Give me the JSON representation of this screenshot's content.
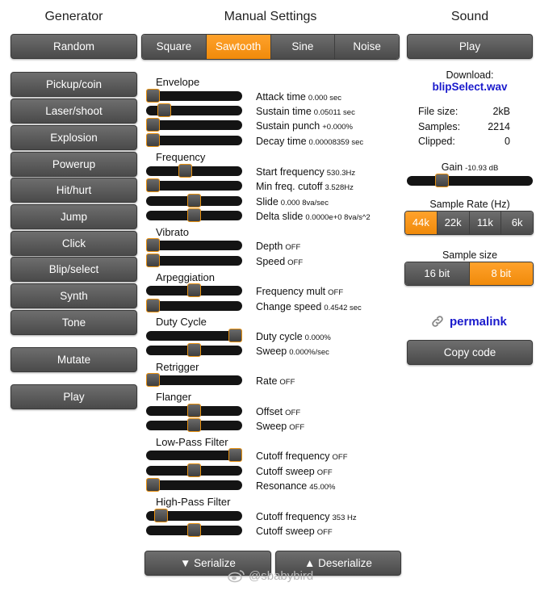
{
  "headers": {
    "generator": "Generator",
    "manual": "Manual Settings",
    "sound": "Sound"
  },
  "generator": {
    "random": "Random",
    "presets": [
      "Pickup/coin",
      "Laser/shoot",
      "Explosion",
      "Powerup",
      "Hit/hurt",
      "Jump",
      "Click",
      "Blip/select",
      "Synth",
      "Tone"
    ],
    "mutate": "Mutate",
    "play": "Play"
  },
  "waveforms": {
    "options": [
      "Square",
      "Sawtooth",
      "Sine",
      "Noise"
    ],
    "selected": "Sawtooth"
  },
  "groups": {
    "envelope": "Envelope",
    "frequency": "Frequency",
    "vibrato": "Vibrato",
    "arpeggiation": "Arpeggiation",
    "duty_cycle": "Duty Cycle",
    "retrigger": "Retrigger",
    "flanger": "Flanger",
    "low_pass": "Low-Pass Filter",
    "high_pass": "High-Pass Filter"
  },
  "params": {
    "attack_time": {
      "label": "Attack time",
      "value": "0.000 sec",
      "level": 0.0
    },
    "sustain_time": {
      "label": "Sustain time",
      "value": "0.05011 sec",
      "level": 0.14
    },
    "sustain_punch": {
      "label": "Sustain punch",
      "value": "+0.000%",
      "level": 0.0
    },
    "decay_time": {
      "label": "Decay time",
      "value": "0.00008359 sec",
      "level": 0.0
    },
    "start_frequency": {
      "label": "Start frequency",
      "value": "530.3Hz",
      "level": 0.39
    },
    "min_freq_cutoff": {
      "label": "Min freq. cutoff",
      "value": "3.528Hz",
      "level": 0.0
    },
    "slide": {
      "label": "Slide",
      "value": "0.000 8va/sec",
      "level": 0.5
    },
    "delta_slide": {
      "label": "Delta slide",
      "value": "0.0000e+0 8va/s^2",
      "level": 0.5
    },
    "vibrato_depth": {
      "label": "Depth",
      "value": "OFF",
      "level": 0.0
    },
    "vibrato_speed": {
      "label": "Speed",
      "value": "OFF",
      "level": 0.0
    },
    "frequency_mult": {
      "label": "Frequency mult",
      "value": "OFF",
      "level": 0.5
    },
    "change_speed": {
      "label": "Change speed",
      "value": "0.4542 sec",
      "level": 0.0
    },
    "duty_cycle": {
      "label": "Duty cycle",
      "value": "0.000%",
      "level": 1.0
    },
    "duty_sweep": {
      "label": "Sweep",
      "value": "0.000%/sec",
      "level": 0.5
    },
    "retrigger_rate": {
      "label": "Rate",
      "value": "OFF",
      "level": 0.0
    },
    "flanger_offset": {
      "label": "Offset",
      "value": "OFF",
      "level": 0.5
    },
    "flanger_sweep": {
      "label": "Sweep",
      "value": "OFF",
      "level": 0.5
    },
    "lp_cutoff_frequency": {
      "label": "Cutoff frequency",
      "value": "OFF",
      "level": 1.0
    },
    "lp_cutoff_sweep": {
      "label": "Cutoff sweep",
      "value": "OFF",
      "level": 0.5
    },
    "lp_resonance": {
      "label": "Resonance",
      "value": "45.00%",
      "level": 0.0
    },
    "hp_cutoff_frequency": {
      "label": "Cutoff frequency",
      "value": "353 Hz",
      "level": 0.1
    },
    "hp_cutoff_sweep": {
      "label": "Cutoff sweep",
      "value": "OFF",
      "level": 0.5
    }
  },
  "actions": {
    "serialize": "▼ Serialize",
    "deserialize": "▲ Deserialize"
  },
  "sound": {
    "play": "Play",
    "download_label": "Download:",
    "download_file": "blipSelect.wav",
    "file_size_label": "File size:",
    "file_size": "2kB",
    "samples_label": "Samples:",
    "samples": "2214",
    "clipped_label": "Clipped:",
    "clipped": "0",
    "gain_label": "Gain",
    "gain_value": "-10.93 dB",
    "gain_level": 0.25,
    "sample_rate_label": "Sample Rate (Hz)",
    "sample_rates": [
      "44k",
      "22k",
      "11k",
      "6k"
    ],
    "sample_rate_selected": "44k",
    "sample_size_label": "Sample size",
    "sample_sizes": [
      "16 bit",
      "8 bit"
    ],
    "sample_size_selected": "8 bit",
    "permalink": "permalink",
    "copy_code": "Copy code"
  },
  "watermark": "@sbabybird",
  "colors": {
    "accent": "#f5920f",
    "button": "#555555",
    "link": "#1a1acc"
  }
}
